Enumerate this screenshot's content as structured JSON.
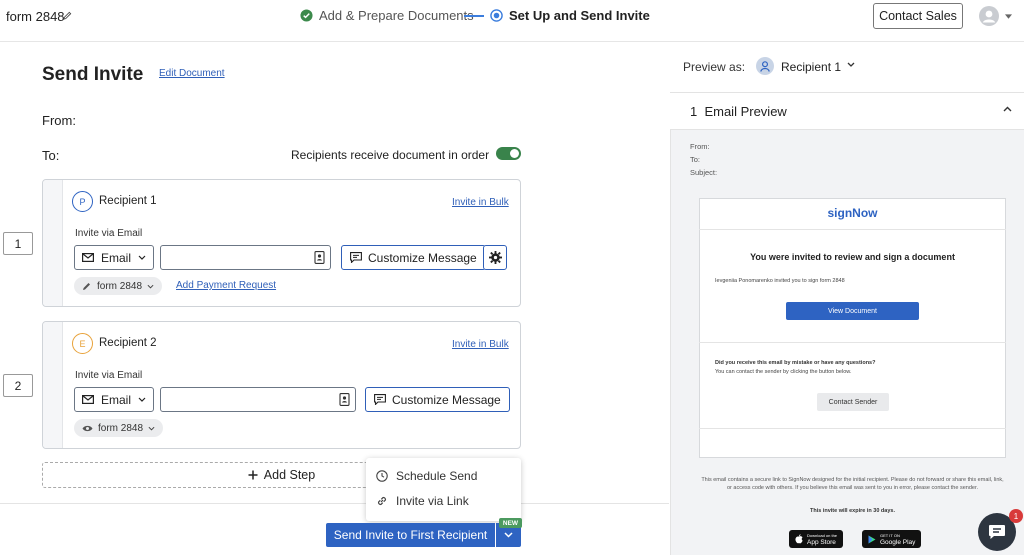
{
  "topbar": {
    "doc_name": "form 2848",
    "steps": [
      {
        "label": "Add & Prepare Documents",
        "state": "done"
      },
      {
        "label": "Set Up and Send Invite",
        "state": "active"
      }
    ],
    "contact_sales": "Contact Sales"
  },
  "main": {
    "title": "Send Invite",
    "edit_document": "Edit Document",
    "from_label": "From:",
    "to_label": "To:",
    "order_label": "Recipients receive document in order",
    "order_toggle_on": true,
    "recipients": [
      {
        "order": "1",
        "initial": "P",
        "name": "Recipient 1",
        "invite_bulk": "Invite in Bulk",
        "invite_via": "Invite via Email",
        "method": "Email",
        "customize": "Customize Message",
        "doc_chip": "form 2848",
        "payment_link": "Add Payment Request",
        "color": "#2e63c2"
      },
      {
        "order": "2",
        "initial": "E",
        "name": "Recipient 2",
        "invite_bulk": "Invite in Bulk",
        "invite_via": "Invite via Email",
        "method": "Email",
        "customize": "Customize Message",
        "doc_chip": "form 2848",
        "color": "#e8a23a"
      }
    ],
    "add_step": "Add Step",
    "dropdown": [
      "Schedule Send",
      "Invite via Link"
    ],
    "send_button": "Send Invite to First Recipient",
    "new_badge": "NEW"
  },
  "preview": {
    "preview_as": "Preview as:",
    "recipient": "Recipient 1",
    "section_title": "1  Email Preview",
    "meta": [
      "From:",
      "To:",
      "Subject:"
    ],
    "logo": "signNow",
    "invited_title": "You were invited to review and sign a document",
    "invited_sub": "Ievgeniia Ponomarenko invited you to sign form 2848",
    "view_document": "View Document",
    "question_title": "Did you receive this email by mistake or have any questions?",
    "question_sub": "You can contact the sender by clicking the button below.",
    "contact_sender": "Contact Sender",
    "disclaimer": "This email contains a secure link to SignNow designed for the initial recipient. Please do not forward or share this email, link, or access code with others. If you believe this email was sent to you in error, please contact the sender.",
    "expire": "This invite will expire in 30 days.",
    "app_store_small": "Download on the",
    "app_store": "App Store",
    "google_small": "GET IT ON",
    "google_play": "Google Play"
  },
  "chat": {
    "badge": "1"
  }
}
